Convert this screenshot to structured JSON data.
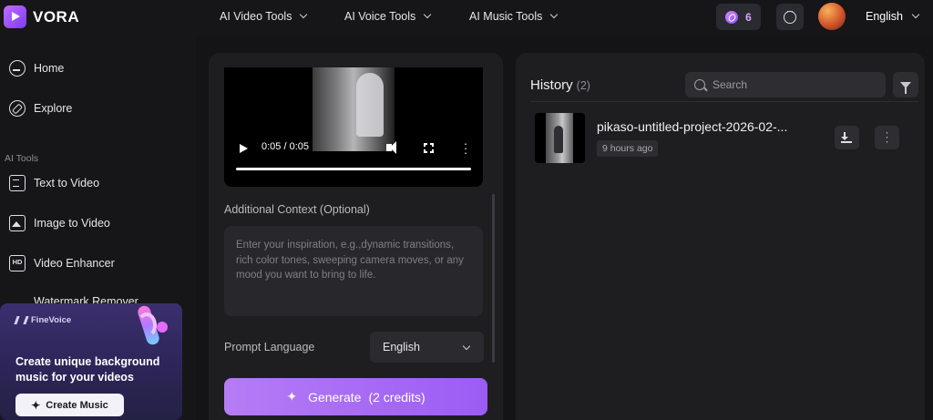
{
  "app": {
    "brand": "VORA"
  },
  "nav": {
    "items": [
      {
        "label": "AI Video Tools"
      },
      {
        "label": "AI Voice Tools"
      },
      {
        "label": "AI Music Tools"
      }
    ],
    "credits": "6",
    "language": "English"
  },
  "sidebar": {
    "items": [
      {
        "label": "Home",
        "icon": "home-icon"
      },
      {
        "label": "Explore",
        "icon": "compass-icon"
      }
    ],
    "section_title": "AI Tools",
    "tools": [
      {
        "label": "Text to Video",
        "icon": "text-video-icon"
      },
      {
        "label": "Image to Video",
        "icon": "image-icon"
      },
      {
        "label": "Video Enhancer",
        "icon": "hd-icon"
      },
      {
        "label": "Watermark Remover",
        "icon": "eraser-icon"
      }
    ],
    "hd_glyph": "HD"
  },
  "promo": {
    "brand": "FineVoice",
    "title": "Create unique background music for your videos",
    "button": "Create Music"
  },
  "player": {
    "time": "0:05 / 0:05",
    "progress": 1.0
  },
  "form": {
    "context_label": "Additional Context (Optional)",
    "context_placeholder": "Enter your inspiration, e.g.,dynamic transitions, rich color tones, sweeping camera moves, or any mood you want to bring to life.",
    "context_value": "",
    "prompt_language_label": "Prompt Language",
    "prompt_language_value": "English",
    "generate_label": "Generate",
    "generate_credits": "(2 credits)"
  },
  "history": {
    "title": "History",
    "count": "(2)",
    "search_placeholder": "Search",
    "items": [
      {
        "name": "pikaso-untitled-project-2026-02-...",
        "time": "9 hours ago"
      }
    ]
  },
  "colors": {
    "accent": "#9b5cf5",
    "background": "#141416",
    "panel": "#1e1e21"
  }
}
